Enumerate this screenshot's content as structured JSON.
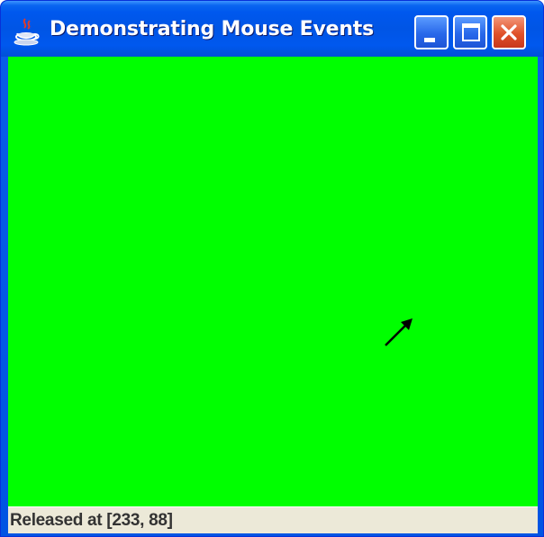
{
  "window": {
    "title": "Demonstrating Mouse Events",
    "app_icon": "java-coffee-cup-icon",
    "buttons": {
      "minimize_icon": "minimize-icon",
      "maximize_icon": "maximize-icon",
      "close_icon": "close-icon"
    }
  },
  "canvas": {
    "background_color": "#00ff00",
    "cursor_icon": "arrow-cursor-icon"
  },
  "status": {
    "text": "Released at [233, 88]"
  },
  "colors": {
    "titlebar": "#0055e5",
    "close_button": "#e0512a",
    "statusbar": "#ece9d8"
  }
}
